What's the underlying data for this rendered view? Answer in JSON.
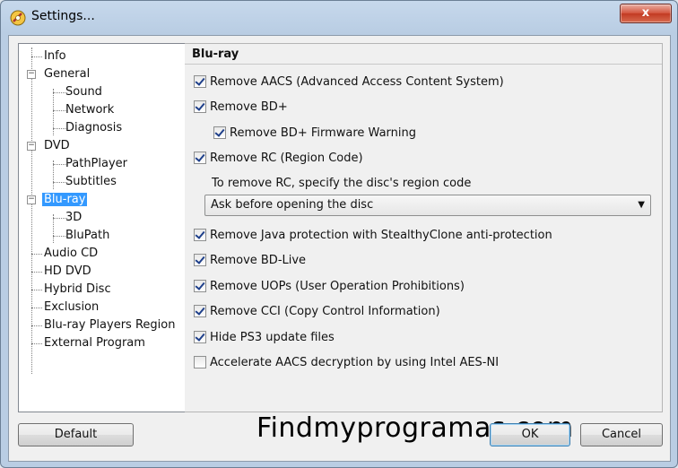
{
  "window": {
    "title": "Settings..."
  },
  "close_label": "x",
  "tree": {
    "items": [
      {
        "label": "Info"
      },
      {
        "label": "General"
      },
      {
        "label": "Sound"
      },
      {
        "label": "Network"
      },
      {
        "label": "Diagnosis"
      },
      {
        "label": "DVD"
      },
      {
        "label": "PathPlayer"
      },
      {
        "label": "Subtitles"
      },
      {
        "label": "Blu-ray"
      },
      {
        "label": "3D"
      },
      {
        "label": "BluPath"
      },
      {
        "label": "Audio CD"
      },
      {
        "label": "HD DVD"
      },
      {
        "label": "Hybrid Disc"
      },
      {
        "label": "Exclusion"
      },
      {
        "label": "Blu-ray Players Region"
      },
      {
        "label": "External Program"
      }
    ],
    "selected": "Blu-ray"
  },
  "panel": {
    "title": "Blu-ray",
    "options": [
      {
        "label": "Remove AACS (Advanced Access Content System)",
        "checked": true
      },
      {
        "label": "Remove BD+",
        "checked": true
      },
      {
        "label": "Remove BD+ Firmware Warning",
        "checked": true
      },
      {
        "label": "Remove RC (Region Code)",
        "checked": true
      },
      {
        "label": "Remove Java protection with StealthyClone anti-protection",
        "checked": true
      },
      {
        "label": "Remove BD-Live",
        "checked": true
      },
      {
        "label": "Remove UOPs (User Operation Prohibitions)",
        "checked": true
      },
      {
        "label": "Remove CCI (Copy Control Information)",
        "checked": true
      },
      {
        "label": "Hide PS3 update files",
        "checked": true
      },
      {
        "label": "Accelerate AACS decryption by using Intel AES-NI",
        "checked": false
      }
    ],
    "region_hint": "To remove RC, specify the disc's region code",
    "region_select": "Ask before opening the disc"
  },
  "watermark": "Findmyprogramas.com",
  "buttons": {
    "default": "Default",
    "ok": "OK",
    "cancel": "Cancel"
  }
}
